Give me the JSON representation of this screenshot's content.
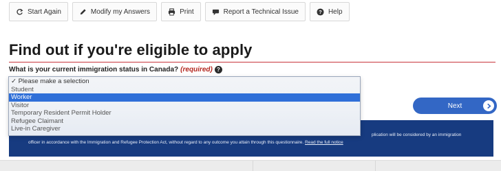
{
  "toolbar": {
    "items": [
      {
        "label": "Start Again",
        "icon": "refresh-icon"
      },
      {
        "label": "Modify my Answers",
        "icon": "pencil-icon"
      },
      {
        "label": "Print",
        "icon": "printer-icon"
      },
      {
        "label": "Report a Technical Issue",
        "icon": "comment-icon"
      },
      {
        "label": "Help",
        "icon": "help-icon"
      }
    ]
  },
  "page": {
    "title": "Find out if you're eligible to apply"
  },
  "question": {
    "label": "What is your current immigration status in Canada?",
    "required": "(required)"
  },
  "status_select": {
    "options": [
      "✓ Please make a selection",
      "Student",
      "Worker",
      "Visitor",
      "Temporary Resident Permit Holder",
      "Refugee Claimant",
      "Live-in Caregiver"
    ],
    "highlighted": "Worker"
  },
  "next_button": {
    "label": "Next"
  },
  "notice": {
    "line1": "plication will be considered by an immigration",
    "line2": "officer in accordance with the Immigration and Refugee Protection Act, without regard to any outcome you attain through this questionnaire.",
    "link": "Read the full notice"
  },
  "colors": {
    "accent_red": "#c8343a",
    "notice_blue": "#173b80",
    "button_blue": "#3367c5",
    "selection_blue": "#2f6fd8"
  }
}
